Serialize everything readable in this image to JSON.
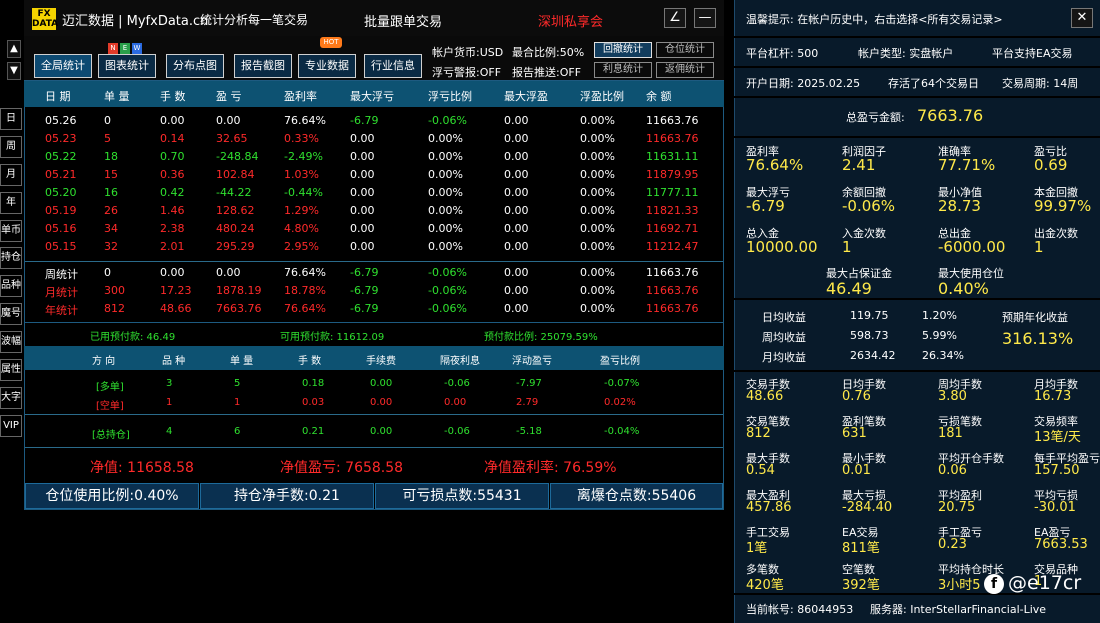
{
  "title": {
    "logo": "FX\nDATA",
    "app": "迈汇数据 | MyfxData.cn",
    "slogan": "统计分析每一笔交易",
    "mode": "批量跟单交易",
    "brand": "深圳私享会"
  },
  "window": {
    "edit": "∠",
    "min": "—"
  },
  "sidebar": {
    "up": "▲",
    "down": "▼",
    "items": [
      "日",
      "周",
      "月",
      "年",
      "单币",
      "持仓",
      "品种",
      "魔号",
      "波幅",
      "属性",
      "大字",
      "VIP"
    ]
  },
  "toolbar": {
    "buttons": [
      "全局统计",
      "图表统计",
      "分布点图",
      "报告截图",
      "专业数据",
      "行业信息"
    ],
    "new_badge": [
      "N",
      "E",
      "W"
    ],
    "hot_badge": "HOT",
    "currency": "帐户货币:USD",
    "max_ratio": "最合比例:50%",
    "float_alert": "浮亏警报:OFF",
    "report_push": "报告推送:OFF",
    "small": [
      "回撤统计",
      "仓位统计",
      "利息统计",
      "返佣统计"
    ]
  },
  "table": {
    "headers": [
      "日 期",
      "单 量",
      "手 数",
      "盈 亏",
      "盈利率",
      "最大浮亏",
      "浮亏比例",
      "最大浮盈",
      "浮盈比例",
      "余 额"
    ],
    "rows": [
      {
        "c": "w",
        "v": [
          "05.26",
          "0",
          "0.00",
          "0.00",
          "76.64%",
          "-6.79",
          "-0.06%",
          "0.00",
          "0.00%",
          "11663.76"
        ]
      },
      {
        "c": "r",
        "v": [
          "05.23",
          "5",
          "0.14",
          "32.65",
          "0.33%",
          "0.00",
          "0.00%",
          "0.00",
          "0.00%",
          "11663.76"
        ]
      },
      {
        "c": "g",
        "v": [
          "05.22",
          "18",
          "0.70",
          "-248.84",
          "-2.49%",
          "0.00",
          "0.00%",
          "0.00",
          "0.00%",
          "11631.11"
        ]
      },
      {
        "c": "r",
        "v": [
          "05.21",
          "15",
          "0.36",
          "102.84",
          "1.03%",
          "0.00",
          "0.00%",
          "0.00",
          "0.00%",
          "11879.95"
        ]
      },
      {
        "c": "g",
        "v": [
          "05.20",
          "16",
          "0.42",
          "-44.22",
          "-0.44%",
          "0.00",
          "0.00%",
          "0.00",
          "0.00%",
          "11777.11"
        ]
      },
      {
        "c": "r",
        "v": [
          "05.19",
          "26",
          "1.46",
          "128.62",
          "1.29%",
          "0.00",
          "0.00%",
          "0.00",
          "0.00%",
          "11821.33"
        ]
      },
      {
        "c": "r",
        "v": [
          "05.16",
          "34",
          "2.38",
          "480.24",
          "4.80%",
          "0.00",
          "0.00%",
          "0.00",
          "0.00%",
          "11692.71"
        ]
      },
      {
        "c": "r",
        "v": [
          "05.15",
          "32",
          "2.01",
          "295.29",
          "2.95%",
          "0.00",
          "0.00%",
          "0.00",
          "0.00%",
          "11212.47"
        ]
      }
    ],
    "summary": [
      {
        "c": "w",
        "v": [
          "周统计",
          "0",
          "0.00",
          "0.00",
          "76.64%",
          "-6.79",
          "-0.06%",
          "0.00",
          "0.00%",
          "11663.76"
        ]
      },
      {
        "c": "r",
        "v": [
          "月统计",
          "300",
          "17.23",
          "1878.19",
          "18.78%",
          "-6.79",
          "-0.06%",
          "0.00",
          "0.00%",
          "11663.76"
        ]
      },
      {
        "c": "r",
        "v": [
          "年统计",
          "812",
          "48.66",
          "7663.76",
          "76.64%",
          "-6.79",
          "-0.06%",
          "0.00",
          "0.00%",
          "11663.76"
        ]
      }
    ]
  },
  "margin": {
    "used": "已用预付款: 46.49",
    "avail": "可用预付款: 11612.09",
    "ratio": "预付款比例: 25079.59%"
  },
  "pos": {
    "headers": [
      "方 向",
      "品 种",
      "单 量",
      "手 数",
      "手续费",
      "隔夜利息",
      "浮动盈亏",
      "盈亏比例"
    ],
    "rows": [
      {
        "c": "g",
        "v": [
          "[多单]",
          "3",
          "5",
          "0.18",
          "0.00",
          "-0.06",
          "-7.97",
          "-0.07%"
        ]
      },
      {
        "c": "r",
        "v": [
          "[空单]",
          "1",
          "1",
          "0.03",
          "0.00",
          "0.00",
          "2.79",
          "0.02%"
        ]
      }
    ],
    "total": {
      "c": "g",
      "v": [
        "[总持仓]",
        "4",
        "6",
        "0.21",
        "0.00",
        "-0.06",
        "-5.18",
        "-0.04%"
      ]
    }
  },
  "net": {
    "equity": "净值: 11658.58",
    "pnl": "净值盈亏: 7658.58",
    "rate": "净值盈利率: 76.59%"
  },
  "stats": [
    "仓位使用比例:0.40%",
    "持仓净手数:0.21",
    "可亏损点数:55431",
    "离爆仓点数:55406"
  ],
  "right": {
    "hint": "温馨提示: 在帐户历史中，右击选择<所有交易记录>",
    "close": "✕",
    "info": [
      "平台杠杆: 500",
      "帐户类型: 实盘帐户",
      "平台支持EA交易",
      "开户日期: 2025.02.25",
      "存活了64个交易日",
      "交易周期: 14周"
    ],
    "total_label": "总盈亏金额:",
    "total_value": "7663.76",
    "grid1": [
      [
        "盈利率",
        "76.64%"
      ],
      [
        "利润因子",
        "2.41"
      ],
      [
        "准确率",
        "77.71%"
      ],
      [
        "盈亏比",
        "0.69"
      ],
      [
        "最大浮亏",
        "-6.79"
      ],
      [
        "余额回撤",
        "-0.06%"
      ],
      [
        "最小净值",
        "28.73"
      ],
      [
        "本金回撤",
        "99.97%"
      ],
      [
        "总入金",
        "10000.00"
      ],
      [
        "入金次数",
        "1"
      ],
      [
        "总出金",
        "-6000.00"
      ],
      [
        "出金次数",
        "1"
      ]
    ],
    "margin_label": "最大占保证金",
    "margin_value": "46.49",
    "pos_label": "最大使用仓位",
    "pos_value": "0.40%",
    "avg": [
      [
        "日均收益",
        "119.75",
        "1.20%"
      ],
      [
        "周均收益",
        "598.73",
        "5.99%"
      ],
      [
        "月均收益",
        "2634.42",
        "26.34%"
      ]
    ],
    "annual_label": "预期年化收益",
    "annual_value": "316.13%",
    "grid2": [
      [
        "交易手数",
        "48.66"
      ],
      [
        "日均手数",
        "0.76"
      ],
      [
        "周均手数",
        "3.80"
      ],
      [
        "月均手数",
        "16.73"
      ],
      [
        "交易笔数",
        "812"
      ],
      [
        "盈利笔数",
        "631"
      ],
      [
        "亏损笔数",
        "181"
      ],
      [
        "交易频率",
        "13笔/天"
      ],
      [
        "最大手数",
        "0.54"
      ],
      [
        "最小手数",
        "0.01"
      ],
      [
        "平均开仓手数",
        "0.06"
      ],
      [
        "每手平均盈亏",
        "157.50"
      ],
      [
        "最大盈利",
        "457.86"
      ],
      [
        "最大亏损",
        "-284.40"
      ],
      [
        "平均盈利",
        "20.75"
      ],
      [
        "平均亏损",
        "-30.01"
      ],
      [
        "手工交易",
        "1笔"
      ],
      [
        "EA交易",
        "811笔"
      ],
      [
        "手工盈亏",
        "0.23"
      ],
      [
        "EA盈亏",
        "7663.53"
      ],
      [
        "多笔数",
        "420笔"
      ],
      [
        "空笔数",
        "392笔"
      ],
      [
        "平均持仓时长",
        "3小时5"
      ],
      [
        "交易品种",
        "1"
      ]
    ],
    "account": "当前帐号: 86044953",
    "server": "服务器: InterStellarFinancial-Live"
  },
  "watermark": {
    "icon": "f",
    "text": "@e17cr"
  },
  "colors": {
    "red": "#ff2a2a",
    "green": "#2fe02f",
    "yellow": "#ffe94a",
    "header": "#0d5272"
  }
}
